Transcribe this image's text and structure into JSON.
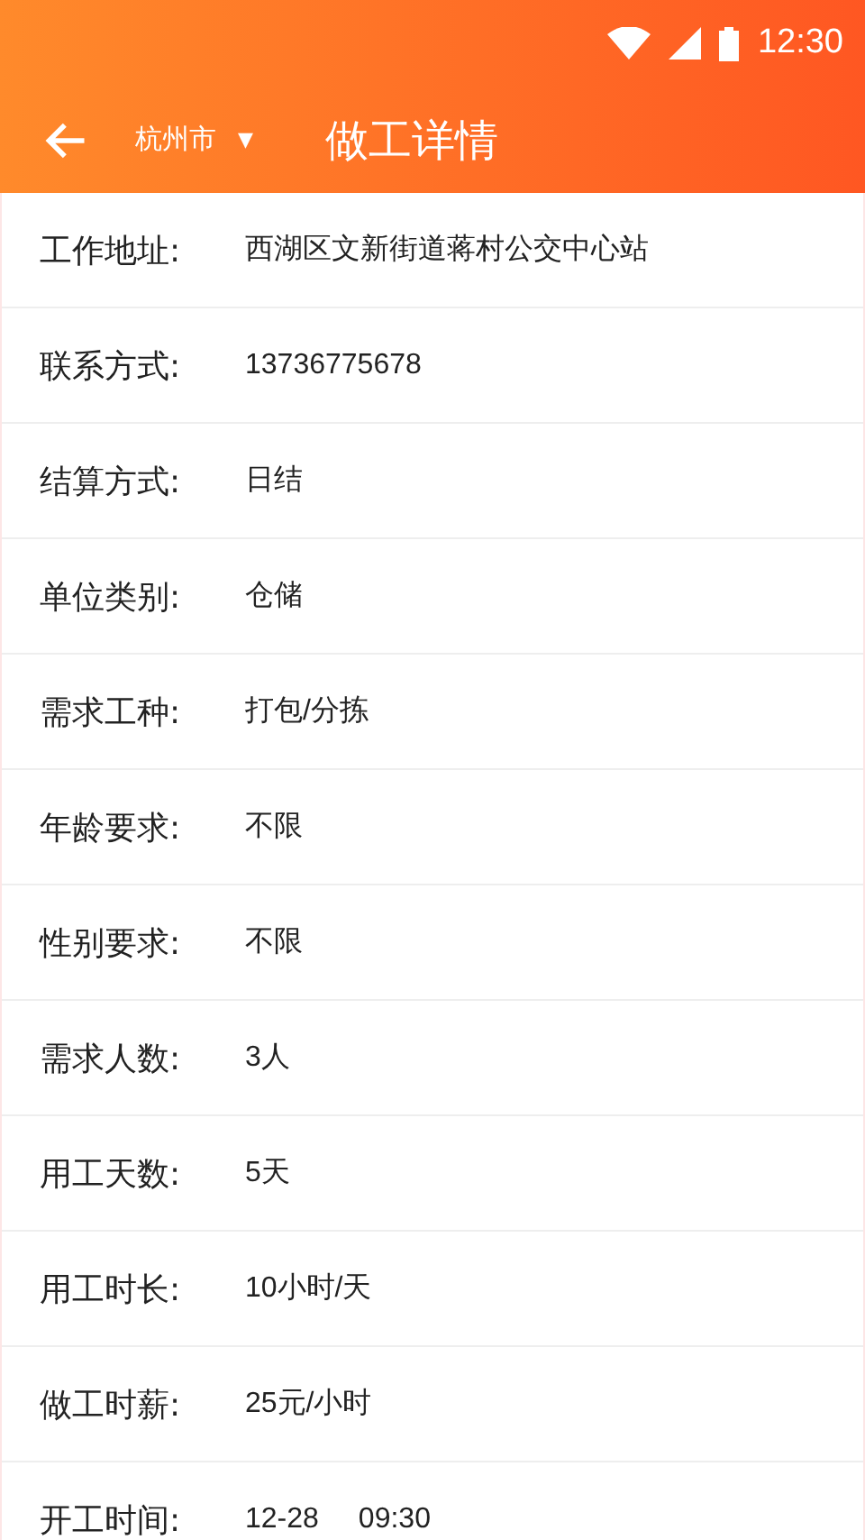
{
  "status_bar": {
    "time": "12:30"
  },
  "toolbar": {
    "city": "杭州市",
    "dropdown": "▼",
    "title": "做工详情"
  },
  "details": [
    {
      "label": "工作地址:",
      "values": [
        "西湖区文新街道蒋村公交中心站"
      ]
    },
    {
      "label": "联系方式:",
      "values": [
        "13736775678"
      ]
    },
    {
      "label": "结算方式:",
      "values": [
        "日结"
      ]
    },
    {
      "label": "单位类别:",
      "values": [
        "仓储"
      ]
    },
    {
      "label": "需求工种:",
      "values": [
        "打包/分拣"
      ]
    },
    {
      "label": "年龄要求:",
      "values": [
        "不限"
      ]
    },
    {
      "label": "性别要求:",
      "values": [
        "不限"
      ]
    },
    {
      "label": "需求人数:",
      "values": [
        "3人"
      ]
    },
    {
      "label": "用工天数:",
      "values": [
        "5天"
      ]
    },
    {
      "label": "用工时长:",
      "values": [
        "10小时/天"
      ]
    },
    {
      "label": "做工时薪:",
      "values": [
        "25元/小时"
      ]
    },
    {
      "label": "开工时间:",
      "values": [
        "12-28",
        "09:30"
      ]
    }
  ]
}
